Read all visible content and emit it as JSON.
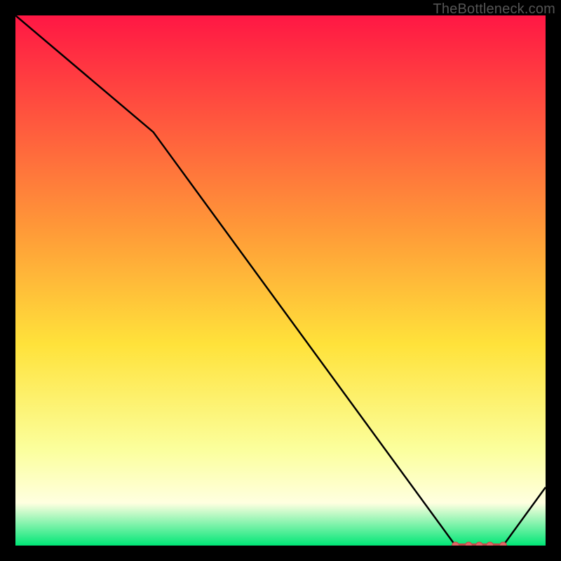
{
  "watermark": "TheBottleneck.com",
  "colors": {
    "background": "#000000",
    "gradient_top": "#ff1744",
    "gradient_upper_mid": "#ff9838",
    "gradient_mid": "#ffe23a",
    "gradient_lower_mid": "#fbff9d",
    "gradient_bottom_band": "#ffffe0",
    "gradient_base": "#00e676",
    "line": "#000000",
    "marker_fill": "#e06666",
    "marker_stroke": "#c24a4a"
  },
  "chart_data": {
    "type": "line",
    "title": "",
    "xlabel": "",
    "ylabel": "",
    "xlim": [
      0,
      100
    ],
    "ylim": [
      0,
      100
    ],
    "x": [
      0,
      26,
      83,
      92,
      100
    ],
    "y": [
      100,
      78,
      0,
      0,
      11
    ],
    "markers": [
      {
        "x": 83,
        "y": 0
      },
      {
        "x": 85.5,
        "y": 0
      },
      {
        "x": 87.5,
        "y": 0
      },
      {
        "x": 89.5,
        "y": 0
      },
      {
        "x": 92,
        "y": 0
      }
    ],
    "markers_connected": true
  }
}
